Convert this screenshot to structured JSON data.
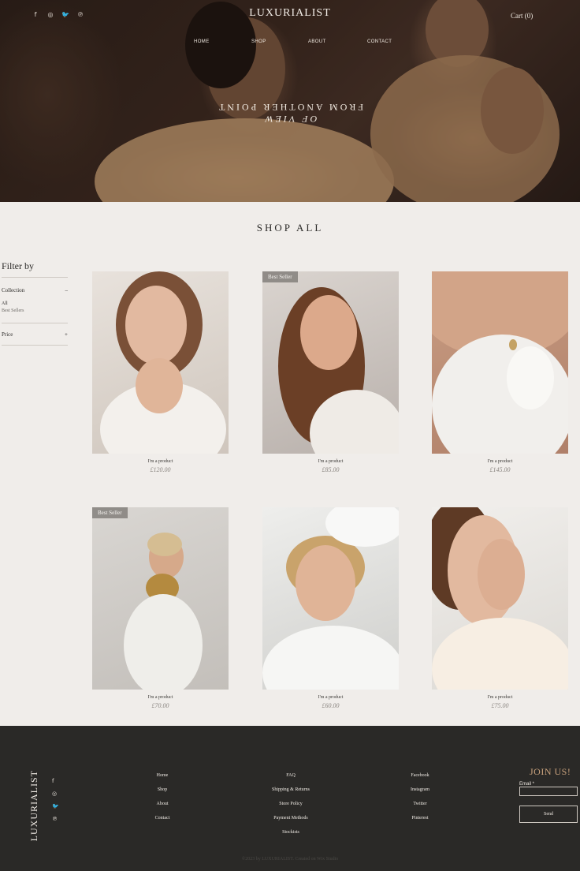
{
  "header": {
    "brand": "LUXURIALIST",
    "cart": "Cart (0)",
    "social_icons": [
      "facebook-icon",
      "instagram-icon",
      "twitter-icon",
      "pinterest-icon"
    ],
    "nav": [
      "HOME",
      "SHOP",
      "ABOUT",
      "CONTACT"
    ],
    "tagline_line1": "FROM ANOTHER POINT",
    "tagline_line2": "OF VIEW"
  },
  "shop": {
    "title": "SHOP ALL",
    "filter": {
      "title": "Filter by",
      "collection_label": "Collection",
      "collection_toggle": "–",
      "collection_items": [
        "All",
        "Best Sellers"
      ],
      "price_label": "Price",
      "price_toggle": "+"
    },
    "products": [
      {
        "name": "I'm a product",
        "price": "£120.00",
        "badge": ""
      },
      {
        "name": "I'm a product",
        "price": "£85.00",
        "badge": "Best Seller"
      },
      {
        "name": "I'm a product",
        "price": "£145.00",
        "badge": ""
      },
      {
        "name": "I'm a product",
        "price": "£70.00",
        "badge": "Best Seller"
      },
      {
        "name": "I'm a product",
        "price": "£60.00",
        "badge": ""
      },
      {
        "name": "I'm a product",
        "price": "£75.00",
        "badge": ""
      }
    ]
  },
  "footer": {
    "brand": "LUXURIALIST",
    "col1": [
      "Home",
      "Shop",
      "About",
      "Contact"
    ],
    "col2": [
      "FAQ",
      "Shipping & Returns",
      "Store Policy",
      "Payment Methods",
      "Stockists"
    ],
    "col3": [
      "Facebook",
      "Instagram",
      "Twitter",
      "Pinterest"
    ],
    "join": "JOIN US!",
    "email_label": "Email *",
    "send": "Send",
    "copyright": "©2023 by LUXURIALIST. Created on Wix Studio"
  },
  "colors": {
    "page_bg": "#f0edea",
    "footer_bg": "#2a2927",
    "accent": "#c9a27d"
  }
}
